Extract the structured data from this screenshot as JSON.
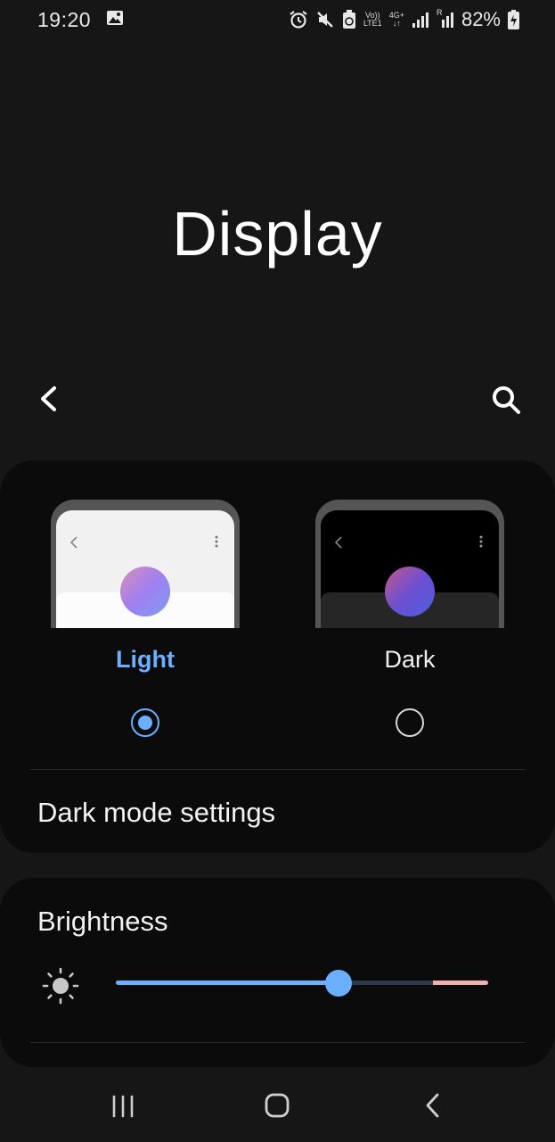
{
  "status_bar": {
    "time": "19:20",
    "battery": "82%",
    "network_top": "Vo))",
    "network_bottom": "LTE1",
    "net_type": "4G+",
    "roaming": "R",
    "icons": [
      "gallery-icon",
      "alarm-icon",
      "mute-icon",
      "recycle-icon",
      "volte-icon",
      "signal-icon",
      "signal-roaming-icon",
      "battery-charging-icon"
    ]
  },
  "header": {
    "title": "Display"
  },
  "theme": {
    "options": [
      {
        "label": "Light",
        "selected": true
      },
      {
        "label": "Dark",
        "selected": false
      }
    ],
    "accent_color": "#6ab0ff",
    "dark_mode_settings_label": "Dark mode settings"
  },
  "brightness": {
    "label": "Brightness",
    "level_fraction": 0.6
  },
  "nav_bar": {
    "icons": [
      "recent-apps-icon",
      "home-icon",
      "back-icon"
    ]
  }
}
